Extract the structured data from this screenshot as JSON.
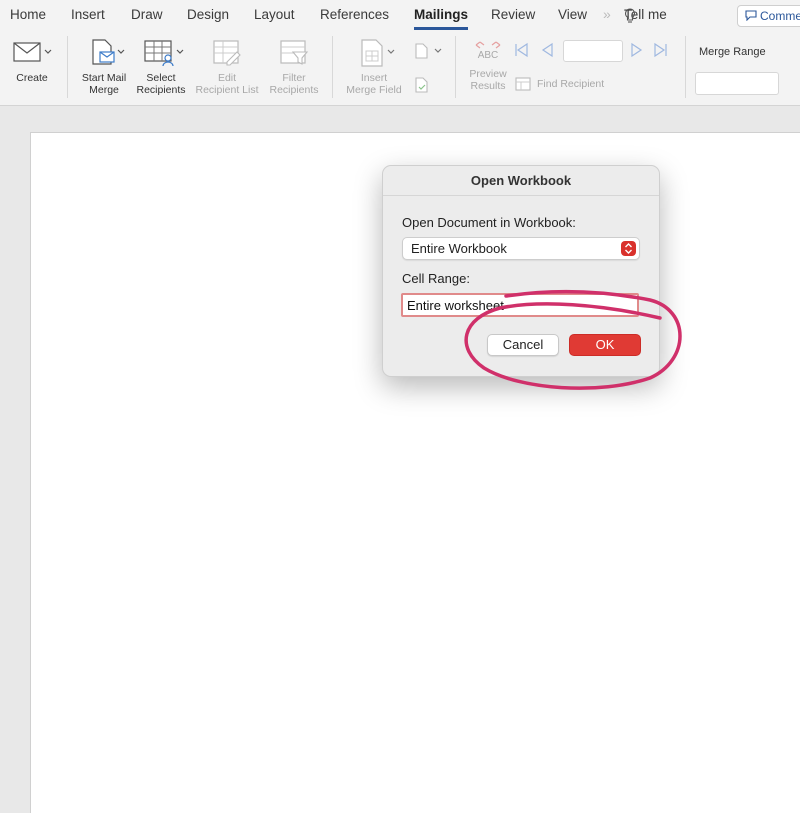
{
  "ribbon_tabs": [
    "Home",
    "Insert",
    "Draw",
    "Design",
    "Layout",
    "References",
    "Mailings",
    "Review",
    "View"
  ],
  "active_tab": "Mailings",
  "tell_me": "Tell me",
  "comments_label": "Comments",
  "ribbon": {
    "create": "Create",
    "start_mail_merge": [
      "Start Mail",
      "Merge"
    ],
    "select_recipients": [
      "Select",
      "Recipients"
    ],
    "edit_recipient_list": [
      "Edit",
      "Recipient List"
    ],
    "filter_recipients": [
      "Filter",
      "Recipients"
    ],
    "insert_merge_field": [
      "Insert",
      "Merge Field"
    ],
    "preview_abc": "ABC",
    "preview_results": [
      "Preview",
      "Results"
    ],
    "find_recipient": "Find Recipient",
    "merge_range": "Merge Range",
    "record_value": "",
    "merge_range_value": ""
  },
  "dialog": {
    "title": "Open Workbook",
    "doc_label": "Open Document in Workbook:",
    "doc_value": "Entire Workbook",
    "range_label": "Cell Range:",
    "range_value": "Entire worksheet",
    "cancel": "Cancel",
    "ok": "OK"
  },
  "colors": {
    "accent": "#2b579a",
    "ok_button": "#e03a34",
    "annotation": "#d0306a"
  }
}
